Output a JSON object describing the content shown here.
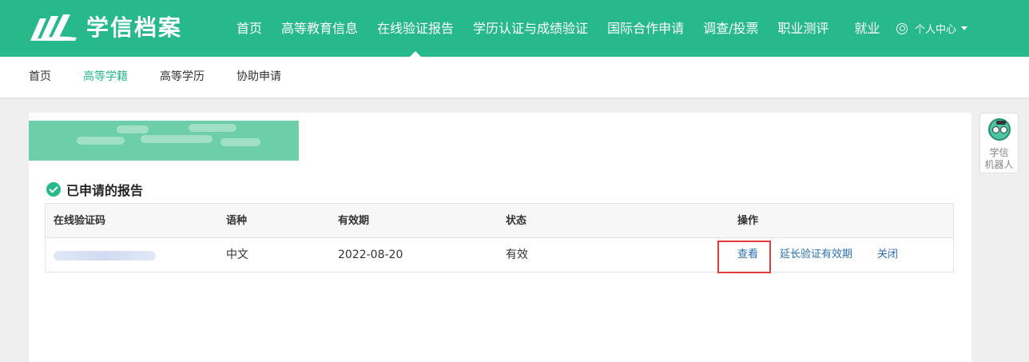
{
  "header": {
    "logo_text": "学信档案",
    "nav": [
      {
        "label": "首页"
      },
      {
        "label": "高等教育信息"
      },
      {
        "label": "在线验证报告",
        "active": true
      },
      {
        "label": "学历认证与成绩验证"
      },
      {
        "label": "国际合作申请"
      },
      {
        "label": "调查/投票"
      },
      {
        "label": "职业测评"
      },
      {
        "label": "就业"
      }
    ],
    "user_menu_label": "个人中心"
  },
  "subnav": {
    "items": [
      {
        "label": "首页"
      },
      {
        "label": "高等学籍",
        "active": true
      },
      {
        "label": "高等学历"
      },
      {
        "label": "协助申请"
      }
    ]
  },
  "section": {
    "title": "已申请的报告"
  },
  "table": {
    "headers": [
      "在线验证码",
      "语种",
      "有效期",
      "状态",
      "操作"
    ],
    "rows": [
      {
        "code": "",
        "language": "中文",
        "expiry": "2022-08-20",
        "status": "有效",
        "actions": [
          "查看",
          "延长验证有效期",
          "关闭"
        ]
      }
    ]
  },
  "robot": {
    "label_line1": "学信",
    "label_line2": "机器人"
  },
  "colors": {
    "brand_green": "#27b98a",
    "link_blue": "#2a6fb4",
    "highlight_red": "#e23b3b"
  }
}
